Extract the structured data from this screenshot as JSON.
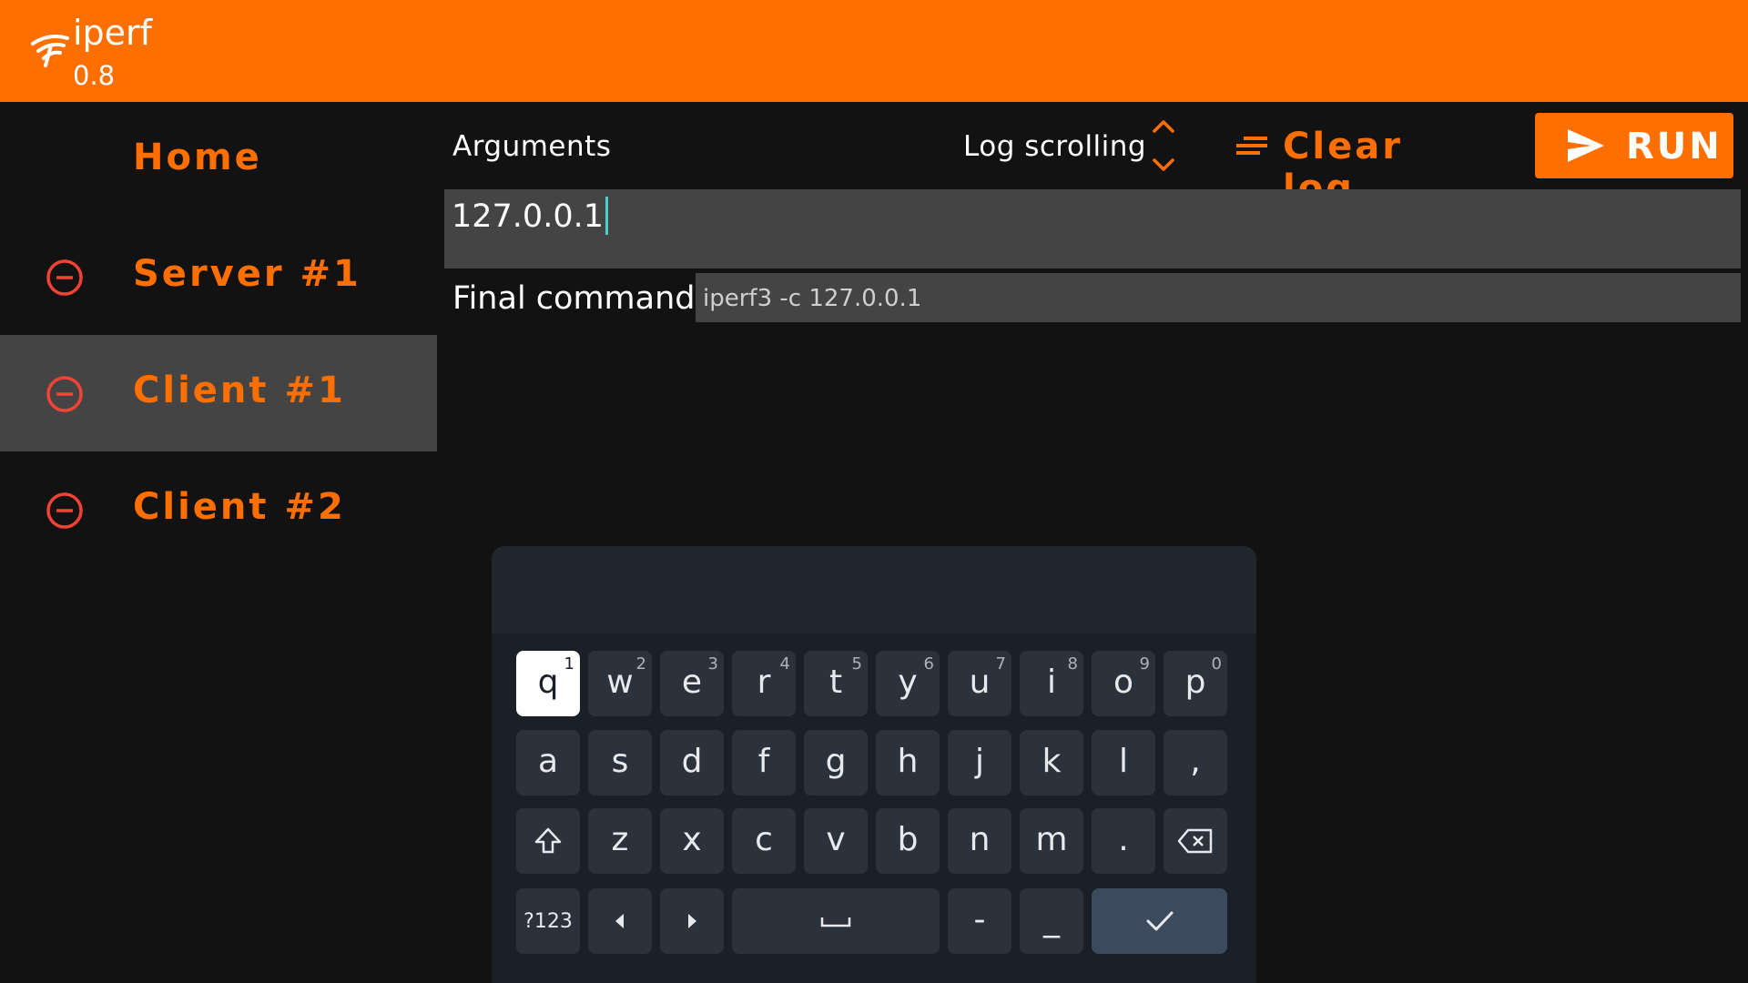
{
  "app": {
    "title": "iperf",
    "version": "0.8"
  },
  "sidebar": {
    "items": [
      {
        "label": "Home",
        "removable": false,
        "selected": false
      },
      {
        "label": "Server #1",
        "removable": true,
        "selected": false
      },
      {
        "label": "Client #1",
        "removable": true,
        "selected": true
      },
      {
        "label": "Client #2",
        "removable": true,
        "selected": false
      }
    ]
  },
  "toolbar": {
    "arguments_label": "Arguments",
    "log_scrolling_label": "Log scrolling",
    "clear_log_label": "Clear log",
    "run_label": "RUN"
  },
  "form": {
    "arguments_value": "127.0.0.1",
    "final_command_label": "Final command",
    "final_command_value": "iperf3 -c 127.0.0.1"
  },
  "keyboard": {
    "row1": [
      {
        "ch": "q",
        "hint": "1"
      },
      {
        "ch": "w",
        "hint": "2"
      },
      {
        "ch": "e",
        "hint": "3"
      },
      {
        "ch": "r",
        "hint": "4"
      },
      {
        "ch": "t",
        "hint": "5"
      },
      {
        "ch": "y",
        "hint": "6"
      },
      {
        "ch": "u",
        "hint": "7"
      },
      {
        "ch": "i",
        "hint": "8"
      },
      {
        "ch": "o",
        "hint": "9"
      },
      {
        "ch": "p",
        "hint": "0"
      }
    ],
    "row2": [
      "a",
      "s",
      "d",
      "f",
      "g",
      "h",
      "j",
      "k",
      "l",
      ","
    ],
    "row3": [
      "z",
      "x",
      "c",
      "v",
      "b",
      "n",
      "m",
      "."
    ],
    "row4": {
      "symbols": "?123",
      "dash": "-",
      "underscore": "_"
    },
    "active_key": "q"
  },
  "colors": {
    "accent": "#ff6f00",
    "remove": "#f44336",
    "caret": "#4dd0c5"
  }
}
